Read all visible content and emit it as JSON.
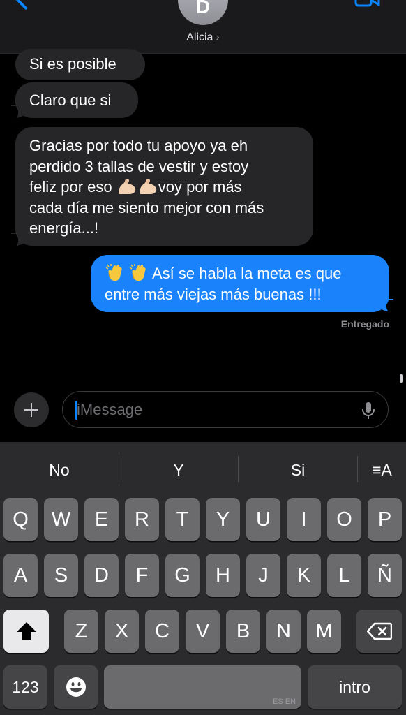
{
  "header": {
    "avatar_initial": "D",
    "contact_name": "Alicia",
    "chevron": "›"
  },
  "messages": [
    {
      "direction": "incoming",
      "text": "Si es posible"
    },
    {
      "direction": "incoming",
      "text": "Claro que si"
    },
    {
      "direction": "incoming",
      "lines": [
        "Gracias por todo tu apoyo ya eh",
        "perdido  3 tallas de vestir  y estoy",
        "feliz por eso ",
        "voy por más",
        "cada día me siento mejor con más",
        "energía...!"
      ],
      "emoji": [
        "💪🏻",
        "💪🏻"
      ]
    },
    {
      "direction": "outgoing",
      "lines": [
        "Así se habla la meta es que",
        "entre más viejas más buenas !!!"
      ],
      "emoji": [
        "👏",
        "👏"
      ]
    }
  ],
  "status": {
    "delivered": "Entregado"
  },
  "compose": {
    "placeholder": "iMessage"
  },
  "predictions": [
    "No",
    "Y",
    "Si"
  ],
  "format_icon": "≡A",
  "keyboard": {
    "row1": [
      "Q",
      "W",
      "E",
      "R",
      "T",
      "Y",
      "U",
      "I",
      "O",
      "P"
    ],
    "row2": [
      "A",
      "S",
      "D",
      "F",
      "G",
      "H",
      "J",
      "K",
      "L",
      "Ñ"
    ],
    "row3": [
      "Z",
      "X",
      "C",
      "V",
      "B",
      "N",
      "M"
    ],
    "numbers": "123",
    "return": "intro",
    "language": "ES EN"
  },
  "colors": {
    "accent": "#0a84ff",
    "outgoing_bubble": "#1a82fb",
    "incoming_bubble": "#262628"
  },
  "icons": [
    "back-chevron-icon",
    "video-camera-icon",
    "plus-icon",
    "mic-icon",
    "shift-icon",
    "backspace-icon",
    "emoji-icon",
    "text-format-icon"
  ]
}
